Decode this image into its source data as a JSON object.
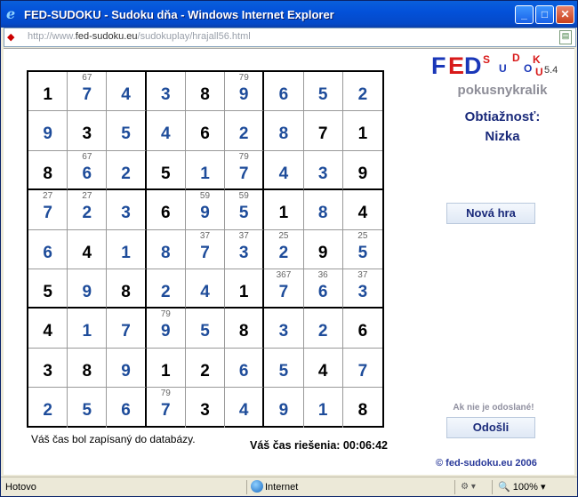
{
  "window": {
    "title": "FED-SUDOKU - Sudoku dňa - Windows Internet Explorer",
    "address_prefix": "http://www.",
    "address_domain": "fed-sudoku.eu",
    "address_path": "/sudokuplay/hrajall56.html"
  },
  "logo": {
    "f": "F",
    "e": "E",
    "d": "D",
    "sudoku_letters": [
      "S",
      "U",
      "D",
      "O",
      "K",
      "U"
    ],
    "version": "5.4",
    "colors": {
      "blue": "#1a37b8",
      "red": "#d81a1a"
    }
  },
  "user": {
    "name": "pokusnykralik"
  },
  "difficulty": {
    "label": "Obtiažnosť:",
    "value": "Nizka"
  },
  "buttons": {
    "new_game": "Nová hra",
    "submit_note": "Ak nie je odoslané!",
    "submit": "Odošli"
  },
  "status": {
    "message": "Váš čas bol zapísaný do databázy.",
    "solve_time": "Váš čas riešenia: 00:06:42"
  },
  "copyright": "© fed-sudoku.eu 2006",
  "statusbar": {
    "text": "Hotovo",
    "zone": "Internet",
    "zoom": "100%"
  },
  "board": {
    "values": [
      [
        1,
        7,
        4,
        3,
        8,
        9,
        6,
        5,
        2
      ],
      [
        9,
        3,
        5,
        4,
        6,
        2,
        8,
        7,
        1
      ],
      [
        8,
        6,
        2,
        5,
        1,
        7,
        4,
        3,
        9
      ],
      [
        7,
        2,
        3,
        6,
        9,
        5,
        1,
        8,
        4
      ],
      [
        6,
        4,
        1,
        8,
        7,
        3,
        2,
        9,
        5
      ],
      [
        5,
        9,
        8,
        2,
        4,
        1,
        7,
        6,
        3
      ],
      [
        4,
        1,
        7,
        9,
        5,
        8,
        3,
        2,
        6
      ],
      [
        3,
        8,
        9,
        1,
        2,
        6,
        5,
        4,
        7
      ],
      [
        2,
        5,
        6,
        7,
        3,
        4,
        9,
        1,
        8
      ]
    ],
    "given": [
      [
        1,
        0,
        0,
        0,
        1,
        0,
        0,
        0,
        0
      ],
      [
        0,
        1,
        0,
        0,
        1,
        0,
        0,
        1,
        1
      ],
      [
        1,
        0,
        0,
        1,
        0,
        0,
        0,
        0,
        1
      ],
      [
        0,
        0,
        0,
        1,
        0,
        0,
        1,
        0,
        1
      ],
      [
        0,
        1,
        0,
        0,
        0,
        0,
        0,
        1,
        0
      ],
      [
        1,
        0,
        1,
        0,
        0,
        1,
        0,
        0,
        0
      ],
      [
        1,
        0,
        0,
        0,
        0,
        1,
        0,
        0,
        1
      ],
      [
        1,
        1,
        0,
        1,
        1,
        0,
        0,
        1,
        0
      ],
      [
        0,
        0,
        0,
        0,
        1,
        0,
        0,
        0,
        1
      ]
    ],
    "candidates": [
      [
        "",
        "67",
        "",
        "",
        "",
        "79",
        "",
        "",
        ""
      ],
      [
        "",
        "",
        "",
        "",
        "",
        "",
        "",
        "",
        ""
      ],
      [
        "",
        "67",
        "",
        "",
        "",
        "79",
        "",
        "",
        ""
      ],
      [
        "27",
        "27",
        "",
        "",
        "59",
        "59",
        "",
        "",
        ""
      ],
      [
        "",
        "",
        "",
        "",
        "37",
        "37",
        "25",
        "",
        "25"
      ],
      [
        "",
        "",
        "",
        "",
        "",
        "",
        "367",
        "36",
        "37"
      ],
      [
        "",
        "",
        "",
        "79",
        "",
        "",
        "",
        "",
        ""
      ],
      [
        "",
        "",
        "",
        "",
        "",
        "",
        "",
        "",
        ""
      ],
      [
        "",
        "",
        "",
        "79",
        "",
        "",
        "",
        "",
        ""
      ]
    ],
    "colors": {
      "given": "#000000",
      "user": "#1E4C9A"
    }
  }
}
